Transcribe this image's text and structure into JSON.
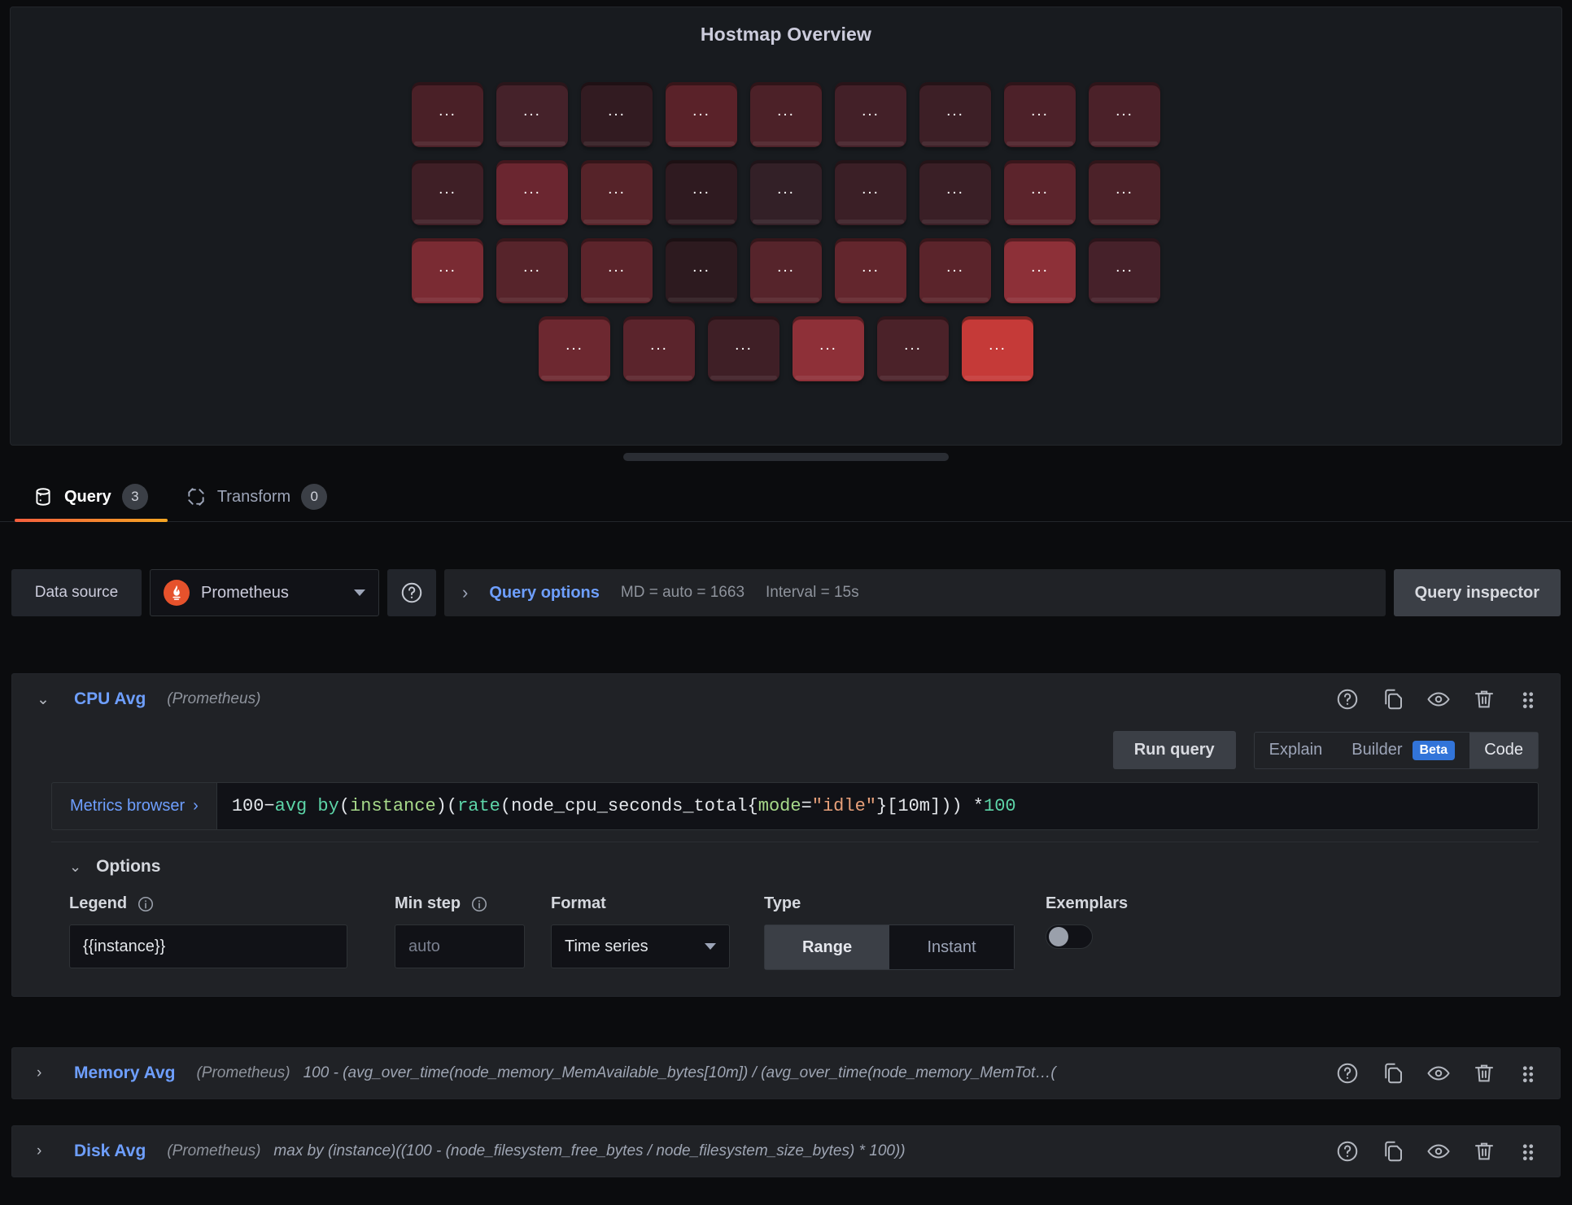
{
  "panel": {
    "title": "Hostmap Overview",
    "tile_label": "...",
    "hostmap": {
      "rows": [
        [
          "#4a2027",
          "#45222a",
          "#321b21",
          "#5a2229",
          "#4c2128",
          "#432028",
          "#3d1f26",
          "#4d2129",
          "#4b2129"
        ],
        [
          "#3f1f26",
          "#6b2630",
          "#562329",
          "#2f1a20",
          "#332027",
          "#3b1f26",
          "#3a1f26",
          "#5c242c",
          "#4c2229"
        ],
        [
          "#7a2b33",
          "#57242b",
          "#5c242b",
          "#2d1a1f",
          "#56242b",
          "#63262d",
          "#5b242b",
          "#8d3038",
          "#46212a"
        ],
        [
          "#6d2830",
          "#5b242c",
          "#3f1f26",
          "#8e3038",
          "#4b2229",
          "#c53a38"
        ]
      ]
    }
  },
  "tabs": [
    {
      "label": "Query",
      "count": "3",
      "icon": "database-icon",
      "active": true
    },
    {
      "label": "Transform",
      "count": "0",
      "icon": "transform-icon",
      "active": false
    }
  ],
  "datasource_row": {
    "label": "Data source",
    "selected": "Prometheus",
    "logo_icon": "prometheus-logo-icon",
    "help_icon": "help-circle-icon",
    "query_options": {
      "caret_icon": "chevron-right-icon",
      "title": "Query options",
      "max_data_points": "MD = auto = 1663",
      "interval": "Interval = 15s"
    },
    "query_inspector": "Query inspector"
  },
  "queries": [
    {
      "name": "CPU Avg",
      "datasource": "(Prometheus)",
      "expanded": true,
      "caret_icon": "chevron-down-icon",
      "actions": [
        "help-circle-icon",
        "duplicate-icon",
        "eye-icon",
        "trash-icon",
        "drag-handle-icon"
      ],
      "toolbar": {
        "run_query": "Run query",
        "explain": "Explain",
        "builder": "Builder",
        "beta_badge": "Beta",
        "code": "Code",
        "active_mode": "Code"
      },
      "metrics_browser": "Metrics browser",
      "metrics_browser_caret": "›",
      "expression_tokens": [
        {
          "t": "100",
          "c": "tk-num"
        },
        {
          "t": " − ",
          "c": "tk-punc"
        },
        {
          "t": "avg by ",
          "c": "tk-fn"
        },
        {
          "t": "(",
          "c": "tk-punc"
        },
        {
          "t": "instance",
          "c": "tk-lbl"
        },
        {
          "t": ")(",
          "c": "tk-punc"
        },
        {
          "t": "rate",
          "c": "tk-fn"
        },
        {
          "t": "(node_cpu_seconds_total{",
          "c": "tk-ident"
        },
        {
          "t": "mode",
          "c": "tk-lbl"
        },
        {
          "t": "=",
          "c": "tk-punc"
        },
        {
          "t": "\"idle\"",
          "c": "tk-str"
        },
        {
          "t": "}[10m])) * ",
          "c": "tk-punc"
        },
        {
          "t": "100",
          "c": "tk-fn"
        }
      ],
      "expression_plain": "100 − avg by (instance)(rate(node_cpu_seconds_total{mode=\"idle\"}[10m])) * 100",
      "options": {
        "header": "Options",
        "caret_icon": "chevron-down-icon",
        "legend_label": "Legend",
        "legend_value": "{{instance}}",
        "min_step_label": "Min step",
        "min_step_placeholder": "auto",
        "format_label": "Format",
        "format_value": "Time series",
        "type_label": "Type",
        "type_range": "Range",
        "type_instant": "Instant",
        "type_selected": "Range",
        "exemplars_label": "Exemplars",
        "exemplars_on": false,
        "info_icon": "info-circle-icon"
      }
    },
    {
      "name": "Memory Avg",
      "datasource": "(Prometheus)",
      "expanded": false,
      "caret_icon": "chevron-right-icon",
      "expression_plain": "100 - (avg_over_time(node_memory_MemAvailable_bytes[10m]) / (avg_over_time(node_memory_MemTot…(",
      "actions": [
        "help-circle-icon",
        "duplicate-icon",
        "eye-icon",
        "trash-icon",
        "drag-handle-icon"
      ]
    },
    {
      "name": "Disk Avg",
      "datasource": "(Prometheus)",
      "expanded": false,
      "caret_icon": "chevron-right-icon",
      "expression_plain": "max by (instance)((100 - (node_filesystem_free_bytes / node_filesystem_size_bytes) * 100))",
      "actions": [
        "help-circle-icon",
        "duplicate-icon",
        "eye-icon",
        "trash-icon",
        "drag-handle-icon"
      ]
    }
  ],
  "colors": {
    "accent_blue": "#6e9fff",
    "accent_orange": "#f55f3e",
    "beta_blue": "#3274d9",
    "prometheus_orange": "#e6522c",
    "panel_bg": "#181b1f",
    "page_bg": "#0b0c0e"
  }
}
